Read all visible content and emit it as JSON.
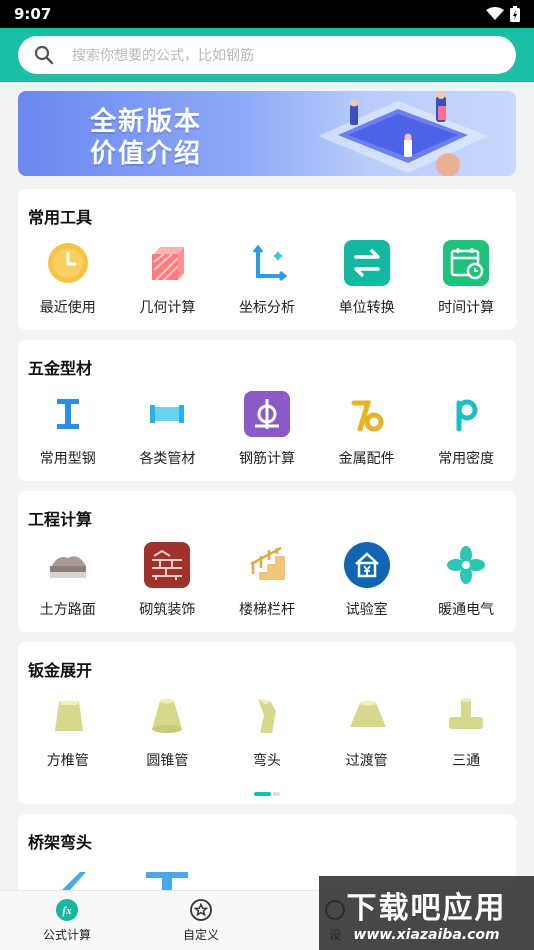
{
  "status": {
    "time": "9:07"
  },
  "search": {
    "placeholder": "搜索你想要的公式，比如钢筋"
  },
  "banner": {
    "line1": "全新版本",
    "line2": "价值介绍"
  },
  "sections": [
    {
      "title": "常用工具",
      "items": [
        {
          "label": "最近使用",
          "icon": "clock-icon"
        },
        {
          "label": "几何计算",
          "icon": "cube-icon"
        },
        {
          "label": "坐标分析",
          "icon": "axis-icon"
        },
        {
          "label": "单位转换",
          "icon": "swap-icon"
        },
        {
          "label": "时间计算",
          "icon": "calendar-icon"
        }
      ]
    },
    {
      "title": "五金型材",
      "items": [
        {
          "label": "常用型钢",
          "icon": "i-beam-icon"
        },
        {
          "label": "各类管材",
          "icon": "pipe-icon"
        },
        {
          "label": "钢筋计算",
          "icon": "rebar-icon"
        },
        {
          "label": "金属配件",
          "icon": "fitting-icon"
        },
        {
          "label": "常用密度",
          "icon": "density-icon"
        }
      ]
    },
    {
      "title": "工程计算",
      "items": [
        {
          "label": "土方路面",
          "icon": "earthwork-icon"
        },
        {
          "label": "砌筑装饰",
          "icon": "brick-icon"
        },
        {
          "label": "楼梯栏杆",
          "icon": "stairs-icon"
        },
        {
          "label": "试验室",
          "icon": "lab-icon"
        },
        {
          "label": "暖通电气",
          "icon": "fan-icon"
        }
      ]
    },
    {
      "title": "钣金展开",
      "items": [
        {
          "label": "方椎管",
          "icon": "square-cone-icon"
        },
        {
          "label": "圆锥管",
          "icon": "round-cone-icon"
        },
        {
          "label": "弯头",
          "icon": "elbow-icon"
        },
        {
          "label": "过渡管",
          "icon": "transition-icon"
        },
        {
          "label": "三通",
          "icon": "tee-icon"
        }
      ]
    },
    {
      "title": "桥架弯头",
      "items": []
    }
  ],
  "tabs": [
    {
      "label": "公式计算",
      "icon": "fx-icon"
    },
    {
      "label": "自定义",
      "icon": "star-icon"
    },
    {
      "label": "设",
      "icon": "settings-icon"
    }
  ],
  "watermark": {
    "line1": "下载吧应用",
    "line2": "www.xiazaiba.com"
  },
  "colors": {
    "accent": "#1bbfa6",
    "olive": "#d6d98c"
  }
}
